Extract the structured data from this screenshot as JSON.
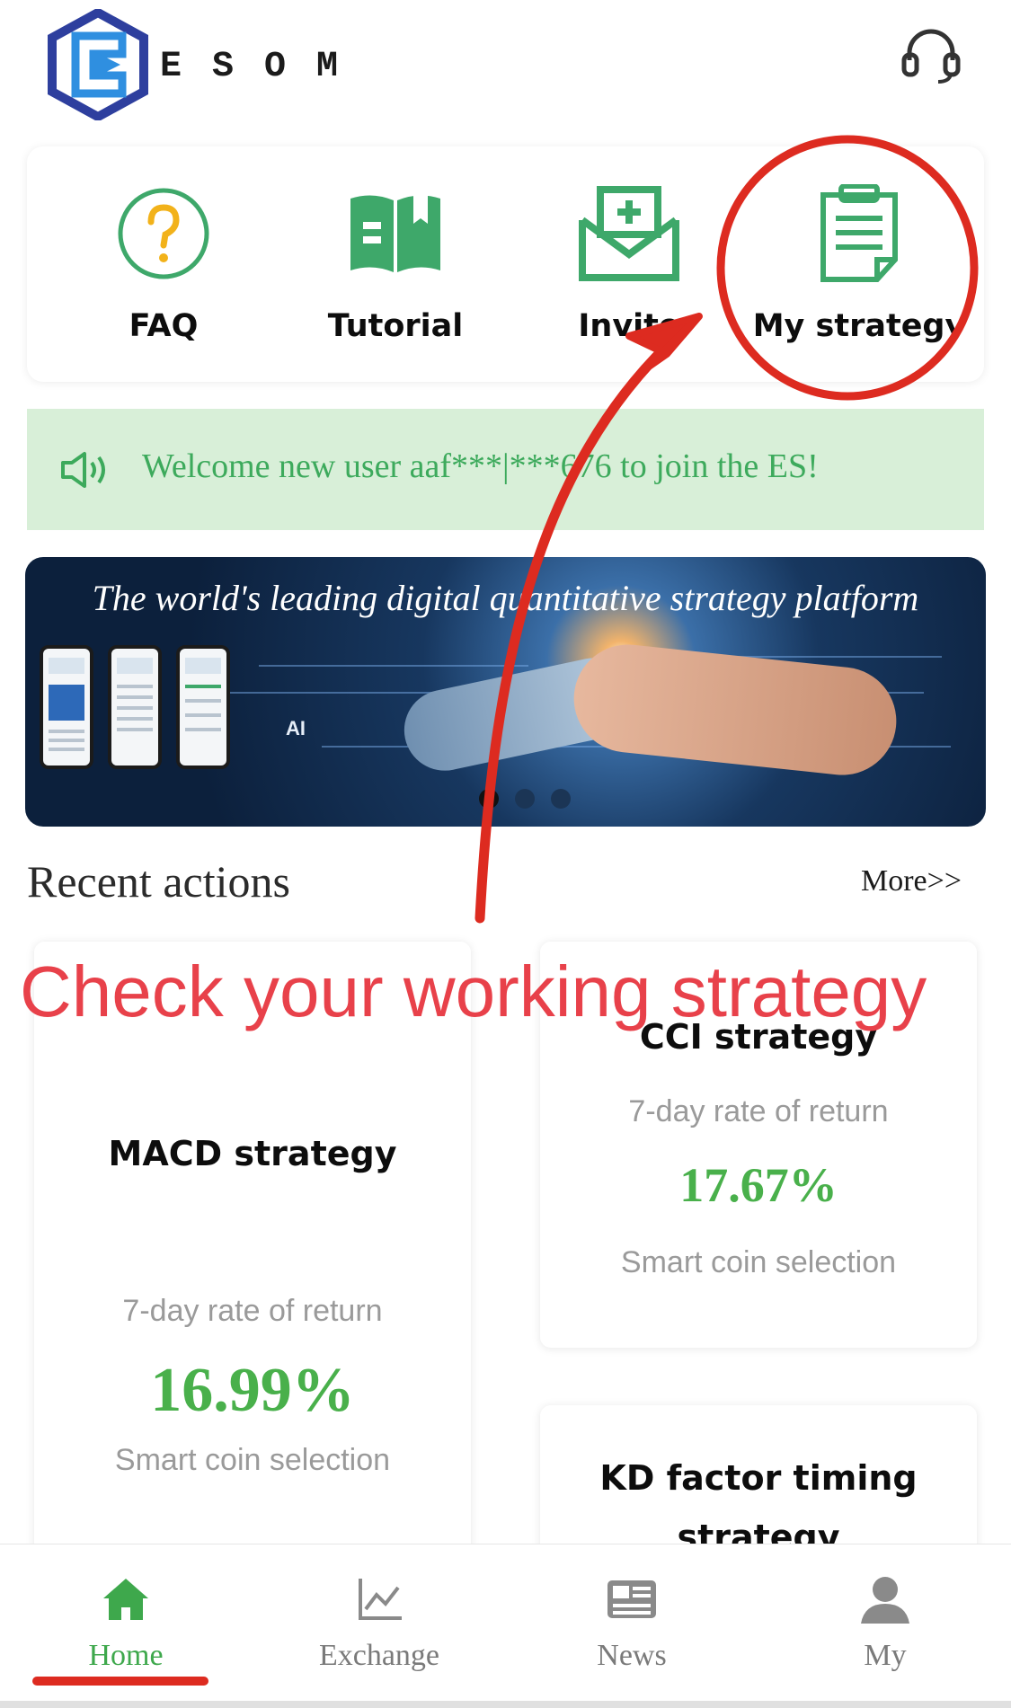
{
  "header": {
    "logo_text": "ESOM",
    "support_icon": "headset-icon"
  },
  "quick_menu": [
    {
      "label": "FAQ",
      "icon": "question-circle-icon"
    },
    {
      "label": "Tutorial",
      "icon": "book-icon"
    },
    {
      "label": "Invite",
      "icon": "envelope-plus-icon"
    },
    {
      "label": "My strategy",
      "icon": "clipboard-icon"
    }
  ],
  "notice": {
    "icon": "speaker-icon",
    "text": "Welcome new user aaf***|***676 to join the ES!"
  },
  "banner": {
    "title": "The world's leading digital quantitative strategy platform",
    "ai_label": "AI"
  },
  "recent": {
    "title": "Recent actions",
    "more": "More>>",
    "cards": [
      {
        "name": "MACD strategy",
        "rate_label": "7-day rate of return",
        "rate": "16.99%",
        "tag": "Smart coin selection"
      },
      {
        "name": "CCI strategy",
        "rate_label": "7-day rate of return",
        "rate": "17.67%",
        "tag": "Smart coin selection"
      },
      {
        "name": "KD factor timing strategy"
      }
    ]
  },
  "annotation": {
    "text": "Check your working strategy",
    "color": "#e8414a"
  },
  "bottom_nav": [
    {
      "label": "Home",
      "icon": "home-icon",
      "active": true
    },
    {
      "label": "Exchange",
      "icon": "chart-line-icon",
      "active": false
    },
    {
      "label": "News",
      "icon": "newspaper-icon",
      "active": false
    },
    {
      "label": "My",
      "icon": "user-icon",
      "active": false
    }
  ],
  "colors": {
    "brand_green": "#3ea84c",
    "notice_bg": "#d8efd8",
    "rate_green": "#49b04b",
    "faq_ring": "#3ea86a",
    "faq_mark": "#f2b21a",
    "annotation_red": "#dd2b20"
  }
}
